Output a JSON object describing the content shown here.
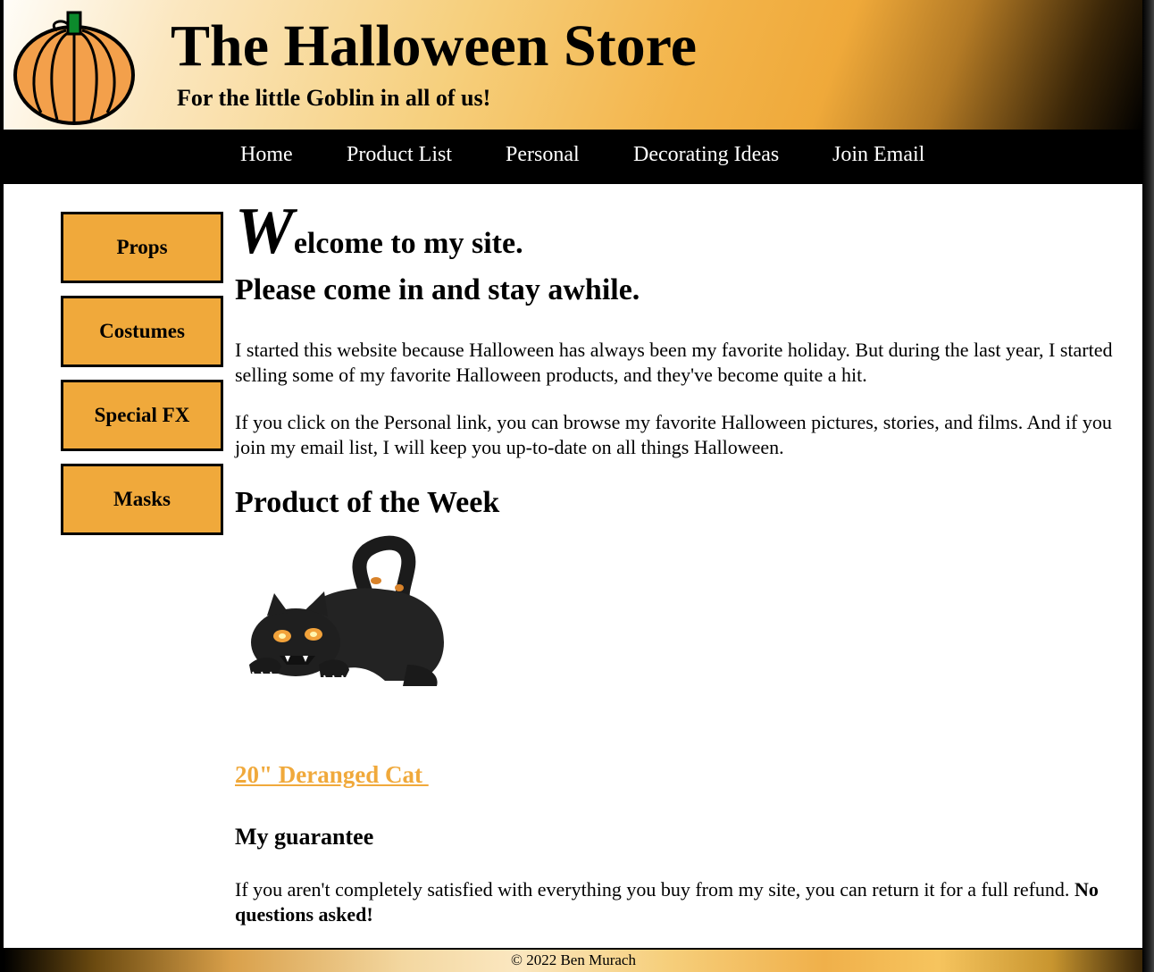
{
  "header": {
    "title": "The Halloween Store",
    "tagline": "For the little Goblin in all of us!",
    "logo_icon": "pumpkin-icon"
  },
  "nav": {
    "items": [
      "Home",
      "Product List",
      "Personal",
      "Decorating Ideas",
      "Join Email"
    ]
  },
  "sidebar": {
    "items": [
      "Props",
      "Costumes",
      "Special FX",
      "Masks"
    ]
  },
  "main": {
    "welcome_dropcap": "W",
    "welcome_rest": "elcome to my site.",
    "welcome_sub": "Please come in and stay awhile.",
    "paragraph1": "I started this website because Halloween has always been my favorite holiday. But during the last year, I started selling some of my favorite Halloween products, and they've become quite a hit.",
    "paragraph2": "If you click on the Personal link, you can browse my favorite Halloween pictures, stories, and films. And if you join my email list, I will keep you up-to-date on all things Halloween.",
    "product_heading": "Product of the Week",
    "product_link": "20\" Deranged Cat ",
    "guarantee_heading": "My guarantee",
    "guarantee_text": "If you aren't completely satisfied with everything you buy from my site, you can return it for a full refund. ",
    "guarantee_bold": "No questions asked!"
  },
  "footer": {
    "copyright": "© 2022 Ben Murach"
  },
  "colors": {
    "accent_orange": "#f0a93b",
    "nav_bg": "#000000"
  }
}
